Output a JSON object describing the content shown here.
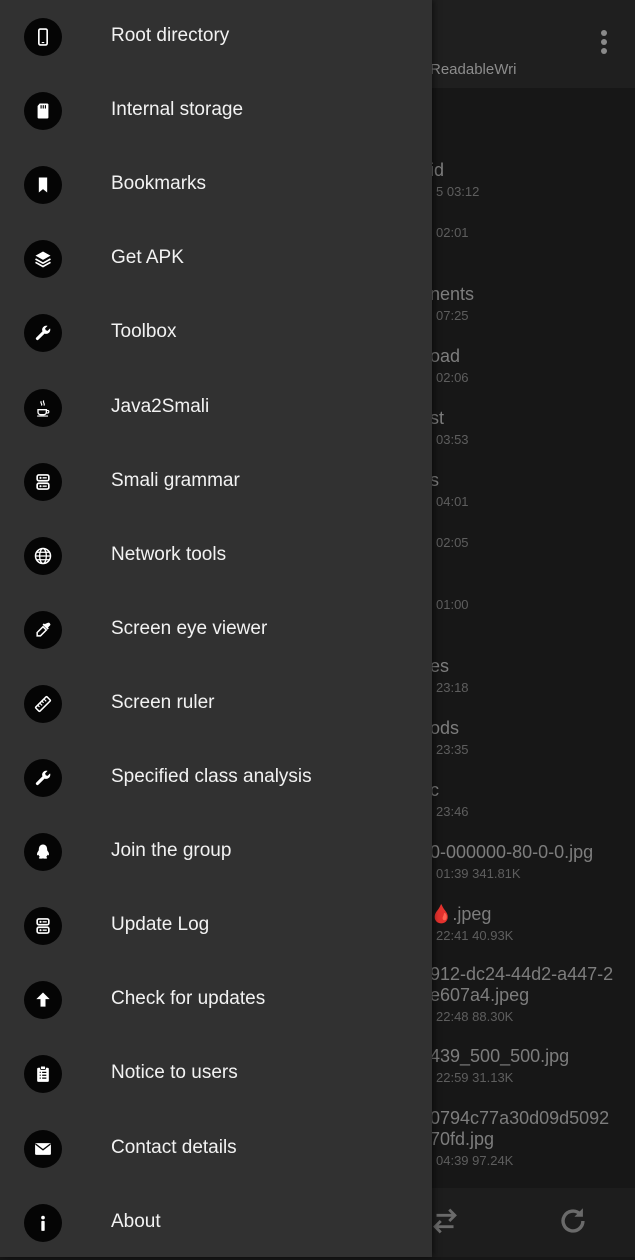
{
  "background": {
    "path_text": "ReadableWri",
    "files": [
      {
        "name": "id",
        "meta": "5 03:12"
      },
      {
        "name": "",
        "meta": "02:01"
      },
      {
        "name": "nents",
        "meta": "07:25"
      },
      {
        "name": "oad",
        "meta": "02:06"
      },
      {
        "name": "st",
        "meta": "03:53"
      },
      {
        "name": "s",
        "meta": "04:01"
      },
      {
        "name": "",
        "meta": "02:05"
      },
      {
        "name": "",
        "meta": "01:00"
      },
      {
        "name": "es",
        "meta": "23:18"
      },
      {
        "name": "ods",
        "meta": "23:35"
      },
      {
        "name": "c",
        "meta": "23:46"
      },
      {
        "name": "0-000000-80-0-0.jpg",
        "meta": "01:39  341.81K"
      },
      {
        "name": "🩸.jpeg",
        "meta": "22:41  40.93K"
      },
      {
        "name": "912-dc24-44d2-a447-2",
        "name2": "e607a4.jpeg",
        "meta": "22:48  88.30K"
      },
      {
        "name": "439_500_500.jpg",
        "meta": "22:59  31.13K"
      },
      {
        "name": "0794c77a30d09d5092",
        "name2": "70fd.jpg",
        "meta": "04:39  97.24K"
      }
    ]
  },
  "drawer": {
    "items": [
      {
        "label": "Root directory",
        "icon": "phone-icon"
      },
      {
        "label": "Internal storage",
        "icon": "sd-card-icon"
      },
      {
        "label": "Bookmarks",
        "icon": "bookmark-icon"
      },
      {
        "label": "Get APK",
        "icon": "layers-icon"
      },
      {
        "label": "Toolbox",
        "icon": "wrench-icon"
      },
      {
        "label": "Java2Smali",
        "icon": "java-cup-icon"
      },
      {
        "label": "Smali grammar",
        "icon": "database-icon"
      },
      {
        "label": "Network tools",
        "icon": "globe-icon"
      },
      {
        "label": "Screen eye viewer",
        "icon": "eyedropper-icon"
      },
      {
        "label": "Screen ruler",
        "icon": "ruler-icon"
      },
      {
        "label": "Specified class analysis",
        "icon": "wrench-icon"
      },
      {
        "label": "Join the group",
        "icon": "qq-penguin-icon"
      },
      {
        "label": "Update Log",
        "icon": "database-icon"
      },
      {
        "label": "Check for updates",
        "icon": "arrow-up-icon"
      },
      {
        "label": "Notice to users",
        "icon": "clipboard-icon"
      },
      {
        "label": "Contact details",
        "icon": "envelope-icon"
      },
      {
        "label": "About",
        "icon": "info-icon"
      }
    ]
  }
}
